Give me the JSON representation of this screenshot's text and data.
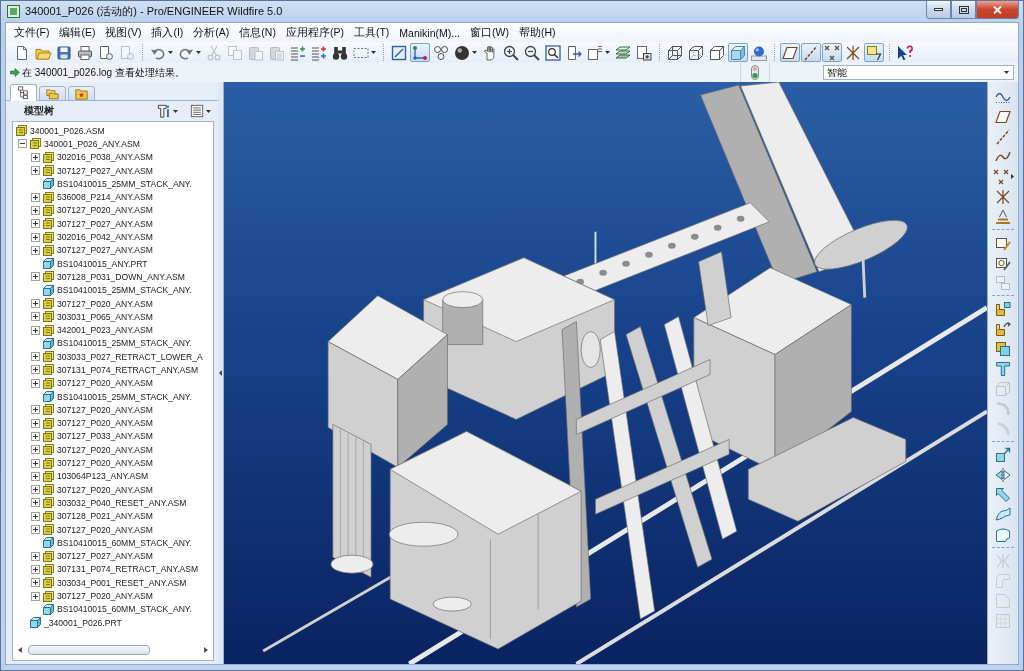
{
  "window": {
    "title": "340001_P026 (活动的) - Pro/ENGINEER Wildfire 5.0"
  },
  "menu": [
    "文件(F)",
    "编辑(E)",
    "视图(V)",
    "插入(I)",
    "分析(A)",
    "信息(N)",
    "应用程序(P)",
    "工具(T)",
    "Manikin(M)...",
    "窗口(W)",
    "帮助(H)"
  ],
  "toolbar": {
    "groups": [
      [
        {
          "pressed": false,
          "disabled": false
        },
        {
          "pressed": false,
          "disabled": false
        },
        {
          "pressed": false,
          "disabled": false
        },
        {
          "pressed": false,
          "disabled": false
        },
        {
          "pressed": false,
          "disabled": false
        },
        {
          "pressed": false,
          "disabled": true
        }
      ],
      [
        {
          "pressed": false,
          "disabled": false
        },
        {
          "pressed": false,
          "disabled": false
        },
        {
          "pressed": false,
          "disabled": true
        },
        {
          "pressed": false,
          "disabled": true
        },
        {
          "pressed": false,
          "disabled": true
        },
        {
          "pressed": false,
          "disabled": true
        },
        {
          "pressed": false,
          "disabled": false
        },
        {
          "pressed": false,
          "disabled": false
        },
        {
          "pressed": false,
          "disabled": false
        },
        {
          "pressed": false,
          "disabled": false
        }
      ],
      [
        {
          "pressed": false,
          "disabled": false
        },
        {
          "pressed": true,
          "disabled": false
        },
        {
          "pressed": false,
          "disabled": false
        },
        {
          "pressed": false,
          "disabled": false
        },
        {
          "pressed": false,
          "disabled": false
        },
        {
          "pressed": false,
          "disabled": false
        },
        {
          "pressed": false,
          "disabled": false
        },
        {
          "pressed": false,
          "disabled": false
        },
        {
          "pressed": false,
          "disabled": false
        },
        {
          "pressed": false,
          "disabled": false
        },
        {
          "pressed": false,
          "disabled": false
        },
        {
          "pressed": false,
          "disabled": false
        }
      ],
      [
        {
          "pressed": false,
          "disabled": false
        },
        {
          "pressed": false,
          "disabled": false
        },
        {
          "pressed": false,
          "disabled": false
        },
        {
          "pressed": true,
          "disabled": false
        },
        {
          "pressed": false,
          "disabled": false
        }
      ],
      [
        {
          "pressed": true,
          "disabled": false
        },
        {
          "pressed": true,
          "disabled": false
        },
        {
          "pressed": true,
          "disabled": false
        },
        {
          "pressed": false,
          "disabled": false
        },
        {
          "pressed": true,
          "disabled": false
        }
      ],
      [
        {
          "pressed": false,
          "disabled": false
        }
      ]
    ]
  },
  "message": {
    "text": "在 340001_p026.log 查看处理结果。"
  },
  "filter": {
    "value": "智能"
  },
  "model_tree": {
    "tabs": [
      {
        "selected": true
      },
      {
        "selected": false
      },
      {
        "selected": false
      }
    ],
    "title": "模型树",
    "items": [
      {
        "label": "340001_P026.ASM",
        "kind": "assembly",
        "children": [
          {
            "label": "340001_P026_ANY.ASM",
            "kind": "assembly",
            "expanded": true,
            "children": [
              {
                "label": "302016_P038_ANY.ASM",
                "kind": "assembly",
                "expanded": false
              },
              {
                "label": "307127_P027_ANY.ASM",
                "kind": "assembly",
                "expanded": false
              },
              {
                "label": "BS10410015_25MM_STACK_ANY.",
                "kind": "part"
              },
              {
                "label": "536008_P214_ANY.ASM",
                "kind": "assembly",
                "expanded": false
              },
              {
                "label": "307127_P020_ANY.ASM",
                "kind": "assembly",
                "expanded": false
              },
              {
                "label": "307127_P027_ANY.ASM",
                "kind": "assembly",
                "expanded": false
              },
              {
                "label": "302016_P042_ANY.ASM",
                "kind": "assembly",
                "expanded": false
              },
              {
                "label": "307127_P027_ANY.ASM",
                "kind": "assembly",
                "expanded": false
              },
              {
                "label": "BS10410015_ANY.PRT",
                "kind": "part"
              },
              {
                "label": "307128_P031_DOWN_ANY.ASM",
                "kind": "assembly",
                "expanded": false
              },
              {
                "label": "BS10410015_25MM_STACK_ANY.",
                "kind": "part"
              },
              {
                "label": "307127_P020_ANY.ASM",
                "kind": "assembly",
                "expanded": false
              },
              {
                "label": "303031_P065_ANY.ASM",
                "kind": "assembly",
                "expanded": false
              },
              {
                "label": "342001_P023_ANY.ASM",
                "kind": "assembly",
                "expanded": false
              },
              {
                "label": "BS10410015_25MM_STACK_ANY.",
                "kind": "part"
              },
              {
                "label": "303033_P027_RETRACT_LOWER_A",
                "kind": "assembly",
                "expanded": false
              },
              {
                "label": "307131_P074_RETRACT_ANY.ASM",
                "kind": "assembly",
                "expanded": false
              },
              {
                "label": "307127_P020_ANY.ASM",
                "kind": "assembly",
                "expanded": false
              },
              {
                "label": "BS10410015_25MM_STACK_ANY.",
                "kind": "part"
              },
              {
                "label": "307127_P020_ANY.ASM",
                "kind": "assembly",
                "expanded": false
              },
              {
                "label": "307127_P020_ANY.ASM",
                "kind": "assembly",
                "expanded": false
              },
              {
                "label": "307127_P033_ANY.ASM",
                "kind": "assembly",
                "expanded": false
              },
              {
                "label": "307127_P020_ANY.ASM",
                "kind": "assembly",
                "expanded": false
              },
              {
                "label": "307127_P020_ANY.ASM",
                "kind": "assembly",
                "expanded": false
              },
              {
                "label": "103064P123_ANY.ASM",
                "kind": "assembly",
                "expanded": false
              },
              {
                "label": "307127_P020_ANY.ASM",
                "kind": "assembly",
                "expanded": false
              },
              {
                "label": "303032_P040_RESET_ANY.ASM",
                "kind": "assembly",
                "expanded": false
              },
              {
                "label": "307128_P021_ANY.ASM",
                "kind": "assembly",
                "expanded": false
              },
              {
                "label": "307127_P020_ANY.ASM",
                "kind": "assembly",
                "expanded": false
              },
              {
                "label": "BS10410015_60MM_STACK_ANY.",
                "kind": "part"
              },
              {
                "label": "307127_P027_ANY.ASM",
                "kind": "assembly",
                "expanded": false
              },
              {
                "label": "307131_P074_RETRACT_ANY.ASM",
                "kind": "assembly",
                "expanded": false
              },
              {
                "label": "303034_P001_RESET_ANY.ASM",
                "kind": "assembly",
                "expanded": false
              },
              {
                "label": "307127_P020_ANY.ASM",
                "kind": "assembly",
                "expanded": false
              },
              {
                "label": "BS10410015_60MM_STACK_ANY.",
                "kind": "part"
              }
            ]
          },
          {
            "label": "_340001_P026.PRT",
            "kind": "part"
          }
        ]
      }
    ]
  },
  "right_toolbar": {
    "groups": [
      [
        {
          "pressed": false,
          "disabled": false
        },
        {
          "pressed": false,
          "disabled": false
        },
        {
          "pressed": false,
          "disabled": false
        },
        {
          "pressed": false,
          "disabled": false
        },
        {
          "pressed": false,
          "disabled": false
        },
        {
          "pressed": false,
          "disabled": false
        },
        {
          "pressed": false,
          "disabled": false
        }
      ],
      [
        {
          "pressed": false,
          "disabled": false
        },
        {
          "pressed": false,
          "disabled": false
        },
        {
          "pressed": false,
          "disabled": true
        }
      ],
      [
        {
          "pressed": false,
          "disabled": false
        },
        {
          "pressed": false,
          "disabled": false
        },
        {
          "pressed": false,
          "disabled": false
        },
        {
          "pressed": false,
          "disabled": false
        },
        {
          "pressed": false,
          "disabled": true
        },
        {
          "pressed": false,
          "disabled": true
        },
        {
          "pressed": false,
          "disabled": true
        }
      ],
      [
        {
          "pressed": false,
          "disabled": false
        },
        {
          "pressed": false,
          "disabled": false
        },
        {
          "pressed": false,
          "disabled": false
        },
        {
          "pressed": false,
          "disabled": false
        },
        {
          "pressed": false,
          "disabled": false
        }
      ],
      [
        {
          "pressed": false,
          "disabled": true
        },
        {
          "pressed": false,
          "disabled": true
        },
        {
          "pressed": false,
          "disabled": true
        },
        {
          "pressed": false,
          "disabled": true
        }
      ]
    ]
  }
}
